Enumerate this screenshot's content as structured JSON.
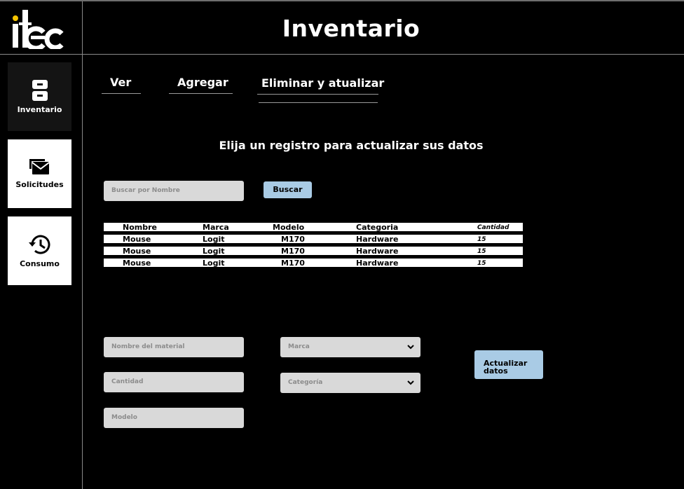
{
  "app": {
    "logo_text": "itec",
    "title": "Inventario"
  },
  "sidebar": {
    "items": [
      {
        "label": "Inventario",
        "icon": "archive-icon"
      },
      {
        "label": "Solicitudes",
        "icon": "mail-icon"
      },
      {
        "label": "Consumo",
        "icon": "history-icon"
      }
    ]
  },
  "tabs": [
    {
      "label": "Ver"
    },
    {
      "label": "Agregar"
    },
    {
      "label": "Eliminar y atualizar"
    }
  ],
  "main": {
    "heading": "Elija un registro para actualizar sus datos",
    "search": {
      "placeholder": "Buscar por Nombre",
      "button": "Buscar"
    }
  },
  "table": {
    "columns": [
      "Nombre",
      "Marca",
      "Modelo",
      "Categoria",
      "Cantidad"
    ],
    "rows": [
      [
        "Mouse",
        "Logit",
        "M170",
        "Hardware",
        "15"
      ],
      [
        "Mouse",
        "Logit",
        "M170",
        "Hardware",
        "15"
      ],
      [
        "Mouse",
        "Logit",
        "M170",
        "Hardware",
        "15"
      ]
    ]
  },
  "form": {
    "nombre_placeholder": "Nombre del material",
    "cantidad_placeholder": "Cantidad",
    "modelo_placeholder": "Modelo",
    "marca_placeholder": "Marca",
    "categoria_placeholder": "Categoría",
    "submit_line1": "Actualizar",
    "submit_line2": "datos"
  },
  "colors": {
    "background": "#000000",
    "input": "#d9d9d9",
    "button": "#a9cbe5",
    "active_nav": "#141414"
  }
}
